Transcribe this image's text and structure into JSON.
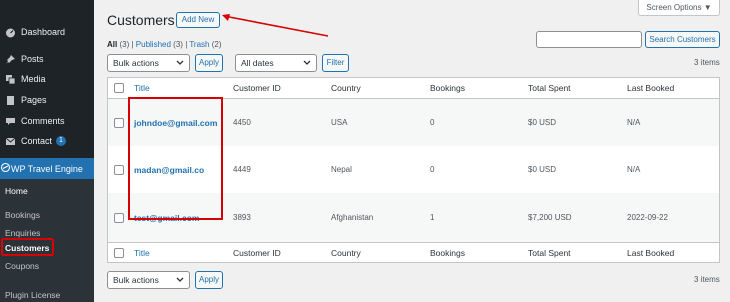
{
  "sidebar": {
    "items": [
      {
        "label": "Dashboard",
        "icon": "dashboard-icon"
      },
      {
        "label": "Posts",
        "icon": "pin-icon"
      },
      {
        "label": "Media",
        "icon": "media-icon"
      },
      {
        "label": "Pages",
        "icon": "pages-icon"
      },
      {
        "label": "Comments",
        "icon": "comment-icon"
      },
      {
        "label": "Contact",
        "icon": "mail-icon",
        "badge": "1"
      },
      {
        "label": "WP Travel Engine",
        "icon": "travel-icon"
      }
    ],
    "submenu": [
      "Home",
      "Bookings",
      "Enquiries",
      "Customers",
      "Coupons",
      "Plugin License"
    ]
  },
  "header": {
    "title": "Customers",
    "add_new": "Add New",
    "screen_options": "Screen Options"
  },
  "filters": {
    "all": "All",
    "all_count": "(3)",
    "published": "Published",
    "published_count": "(3)",
    "trash": "Trash",
    "trash_count": "(2)",
    "sep": "|"
  },
  "search": {
    "button": "Search Customers"
  },
  "top_nav": {
    "bulk_actions": "Bulk actions",
    "apply": "Apply",
    "dates": "All dates",
    "filter": "Filter",
    "items": "3 items"
  },
  "bottom_nav": {
    "bulk_actions": "Bulk actions",
    "apply": "Apply",
    "items": "3 items"
  },
  "table": {
    "columns": [
      "Title",
      "Customer ID",
      "Country",
      "Bookings",
      "Total Spent",
      "Last Booked"
    ],
    "rows": [
      {
        "title": "johndoe@gmail.com",
        "id": "4450",
        "country": "USA",
        "bookings": "0",
        "spent": "$0 USD",
        "last": "N/A"
      },
      {
        "title": "madan@gmail.co",
        "id": "4449",
        "country": "Nepal",
        "bookings": "0",
        "spent": "$0 USD",
        "last": "N/A"
      },
      {
        "title": "test@gmail.com",
        "id": "3893",
        "country": "Afghanistan",
        "bookings": "1",
        "spent": "$7,200 USD",
        "last": "2022-09-22"
      }
    ]
  },
  "colors": {
    "accent": "#2271b1",
    "highlight": "#d60000",
    "sidebar": "#1d2327"
  }
}
